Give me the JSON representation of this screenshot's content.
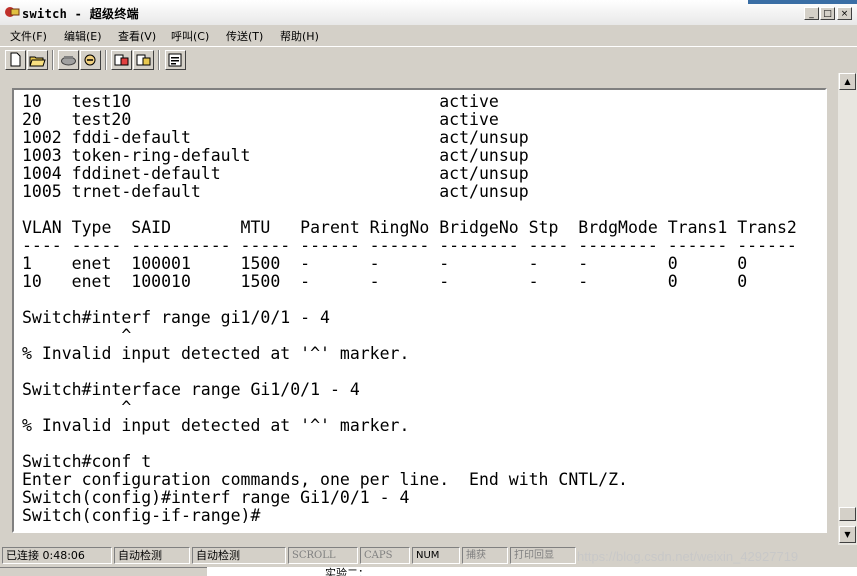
{
  "window": {
    "title": "switch - 超级终端",
    "minimize": "_",
    "maximize": "□",
    "close": "×"
  },
  "menu": [
    {
      "label": "文件(F)"
    },
    {
      "label": "编辑(E)"
    },
    {
      "label": "查看(V)"
    },
    {
      "label": "呼叫(C)"
    },
    {
      "label": "传送(T)"
    },
    {
      "label": "帮助(H)"
    }
  ],
  "toolbar": {
    "icons": [
      "new-icon",
      "open-icon",
      "phone-icon",
      "disconnect-icon",
      "send-icon",
      "receive-icon",
      "properties-icon"
    ]
  },
  "terminal": {
    "lines": [
      "10   test10                               active",
      "20   test20                               active",
      "1002 fddi-default                         act/unsup",
      "1003 token-ring-default                   act/unsup",
      "1004 fddinet-default                      act/unsup",
      "1005 trnet-default                        act/unsup",
      "",
      "VLAN Type  SAID       MTU   Parent RingNo BridgeNo Stp  BrdgMode Trans1 Trans2",
      "---- ----- ---------- ----- ------ ------ -------- ---- -------- ------ ------",
      "1    enet  100001     1500  -      -      -        -    -        0      0",
      "10   enet  100010     1500  -      -      -        -    -        0      0",
      "",
      "Switch#interf range gi1/0/1 - 4",
      "          ^",
      "% Invalid input detected at '^' marker.",
      "",
      "Switch#interface range Gi1/0/1 - 4",
      "          ^",
      "% Invalid input detected at '^' marker.",
      "",
      "Switch#conf t",
      "Enter configuration commands, one per line.  End with CNTL/Z.",
      "Switch(config)#interf range Gi1/0/1 - 4",
      "Switch(config-if-range)#"
    ]
  },
  "status": {
    "connected": "已连接 0:48:06",
    "detect1": "自动检测",
    "detect2": "自动检测",
    "scroll": "SCROLL",
    "caps": "CAPS",
    "num": "NUM",
    "capture": "捕获",
    "print_echo": "打印回显"
  },
  "watermark": "https://blog.csdn.net/weixin_42927719",
  "taskbar_caption": "实验二："
}
